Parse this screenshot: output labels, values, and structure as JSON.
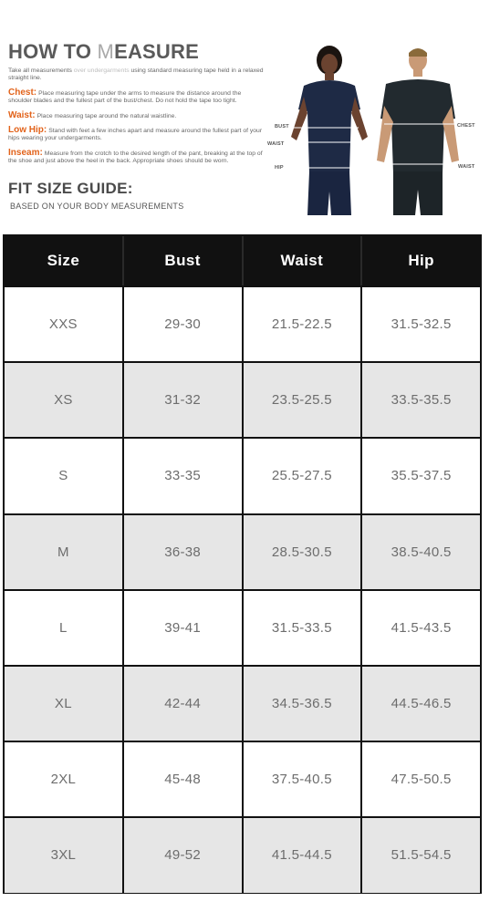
{
  "guide": {
    "title_a": "HOW TO ",
    "title_b": "M",
    "title_c": "EASURE",
    "intro_a": "Take all measurements ",
    "intro_b": "over undergarments",
    "intro_c": " using standard measuring tape held in a relaxed straight line.",
    "measurements": [
      {
        "term": "Chest:",
        "text": "Place measuring tape under the arms to measure the distance around the shoulder blades and the fullest part of the bust/chest. Do not hold the tape too tight."
      },
      {
        "term": "Waist:",
        "text": "Place measuring tape around the natural waistline."
      },
      {
        "term": "Low Hip:",
        "text": "Stand with feet a few inches apart and measure around the fullest part of your hips wearing your undergarments."
      },
      {
        "term": "Inseam:",
        "text": "Measure from the crotch to the desired length of the pant, breaking at the top of the shoe and just above the heel in the back. Appropriate shoes should be worn."
      }
    ],
    "fit_title": "FIT SIZE GUIDE:",
    "fit_subtitle": "BASED ON YOUR BODY MEASUREMENTS",
    "illustration_labels": {
      "bust": "BUST",
      "waist_left": "WAIST",
      "hip": "HIP",
      "chest": "CHEST",
      "waist_right": "WAIST"
    }
  },
  "table": {
    "headers": [
      "Size",
      "Bust",
      "Waist",
      "Hip"
    ],
    "rows": [
      [
        "XXS",
        "29-30",
        "21.5-22.5",
        "31.5-32.5"
      ],
      [
        "XS",
        "31-32",
        "23.5-25.5",
        "33.5-35.5"
      ],
      [
        "S",
        "33-35",
        "25.5-27.5",
        "35.5-37.5"
      ],
      [
        "M",
        "36-38",
        "28.5-30.5",
        "38.5-40.5"
      ],
      [
        "L",
        "39-41",
        "31.5-33.5",
        "41.5-43.5"
      ],
      [
        "XL",
        "42-44",
        "34.5-36.5",
        "44.5-46.5"
      ],
      [
        "2XL",
        "45-48",
        "37.5-40.5",
        "47.5-50.5"
      ],
      [
        "3XL",
        "49-52",
        "41.5-44.5",
        "51.5-54.5"
      ]
    ]
  },
  "colors": {
    "accent": "#e2631b",
    "header_bg": "#111111",
    "row_shade": "#e6e6e6",
    "scrub": "#1e2a45"
  }
}
